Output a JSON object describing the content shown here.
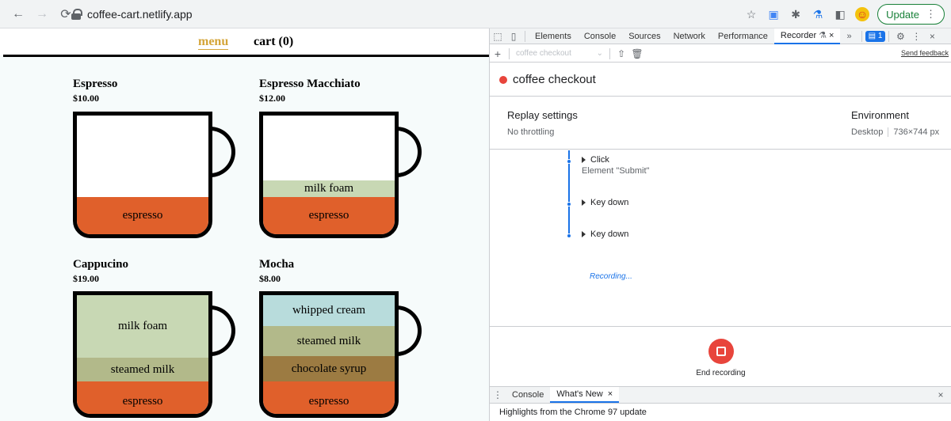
{
  "browser": {
    "url": "coffee-cart.netlify.app",
    "update_label": "Update"
  },
  "site": {
    "nav": {
      "menu": "menu",
      "cart": "cart (0)"
    },
    "items": [
      {
        "name": "Espresso",
        "price": "$10.00",
        "layers": [
          "espresso"
        ]
      },
      {
        "name": "Espresso Macchiato",
        "price": "$12.00",
        "layers": [
          "milk foam",
          "espresso"
        ]
      },
      {
        "name": "Cappucino",
        "price": "$19.00",
        "layers": [
          "milk foam",
          "steamed milk",
          "espresso"
        ]
      },
      {
        "name": "Mocha",
        "price": "$8.00",
        "layers": [
          "whipped cream",
          "steamed milk",
          "chocolate syrup",
          "espresso"
        ]
      }
    ],
    "colors": {
      "espresso": "#e0602b",
      "milk_foam": "#c8d8b4",
      "steamed_milk": "#b2b98a",
      "whipped_cream": "#b8dcdc",
      "chocolate_syrup": "#9c7b42",
      "accent": "#d4a437"
    }
  },
  "devtools": {
    "tabs": [
      "Elements",
      "Console",
      "Sources",
      "Network",
      "Performance",
      "Recorder"
    ],
    "active_tab": "Recorder",
    "more": "»",
    "issues_badge": "1",
    "recording_select": "coffee checkout",
    "send_feedback": "Send feedback",
    "recording_title": "coffee checkout",
    "replay_settings": {
      "heading": "Replay settings",
      "value": "No throttling"
    },
    "environment": {
      "heading": "Environment",
      "device": "Desktop",
      "size": "736×744 px"
    },
    "steps": [
      {
        "title": "Click",
        "detail": "Element \"Submit\""
      },
      {
        "title": "Key down",
        "detail": ""
      },
      {
        "title": "Key down",
        "detail": ""
      }
    ],
    "recording_status": "Recording...",
    "end_label": "End recording",
    "drawer_tabs": [
      "Console",
      "What's New"
    ],
    "drawer_active": "What's New",
    "drawer_text": "Highlights from the Chrome 97 update"
  }
}
